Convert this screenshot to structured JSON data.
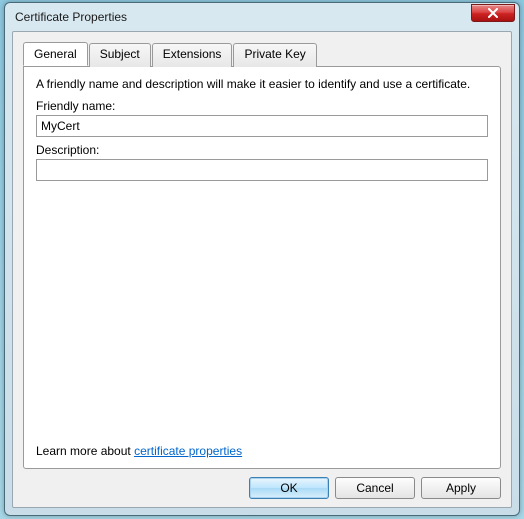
{
  "window": {
    "title": "Certificate Properties"
  },
  "tabs": {
    "general": "General",
    "subject": "Subject",
    "extensions": "Extensions",
    "private_key": "Private Key"
  },
  "general": {
    "intro": "A friendly name and description will make it easier to identify and use a certificate.",
    "friendly_name_label": "Friendly name:",
    "friendly_name_value": "MyCert",
    "description_label": "Description:",
    "description_value": "",
    "learn_prefix": "Learn more about ",
    "learn_link": "certificate properties"
  },
  "buttons": {
    "ok": "OK",
    "cancel": "Cancel",
    "apply": "Apply"
  }
}
